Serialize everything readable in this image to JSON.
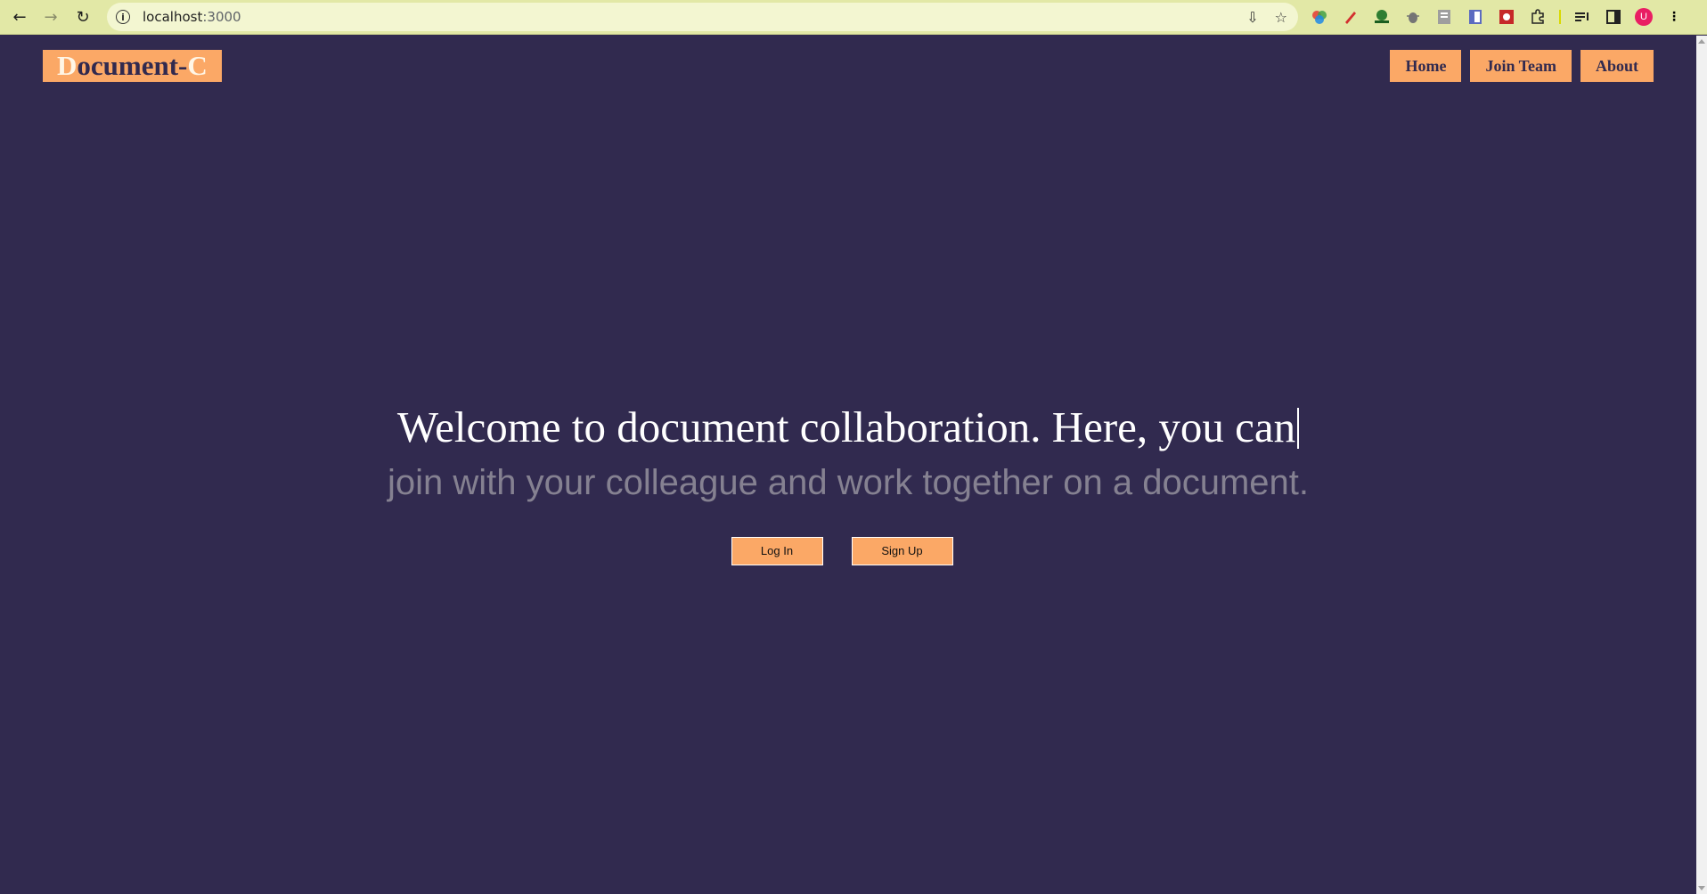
{
  "browser": {
    "url_host": "localhost",
    "url_port": ":3000",
    "back_icon": "←",
    "forward_icon": "→",
    "reload_icon": "↻",
    "info_icon": "i",
    "install_icon": "⇩",
    "star_icon": "☆",
    "avatar_letter": "U",
    "menu_icon": "⋮"
  },
  "header": {
    "logo_first": "D",
    "logo_middle": "ocument-",
    "logo_last": "C",
    "nav": [
      "Home",
      "Join Team",
      "About"
    ]
  },
  "hero": {
    "headline": "Welcome to document collaboration. Here, you can",
    "subline": "join with your colleague and work together on a document."
  },
  "actions": {
    "login": "Log In",
    "signup": "Sign Up"
  },
  "colors": {
    "background": "#312a4f",
    "accent": "#fba866",
    "browser_bar": "#e2e8a6"
  }
}
